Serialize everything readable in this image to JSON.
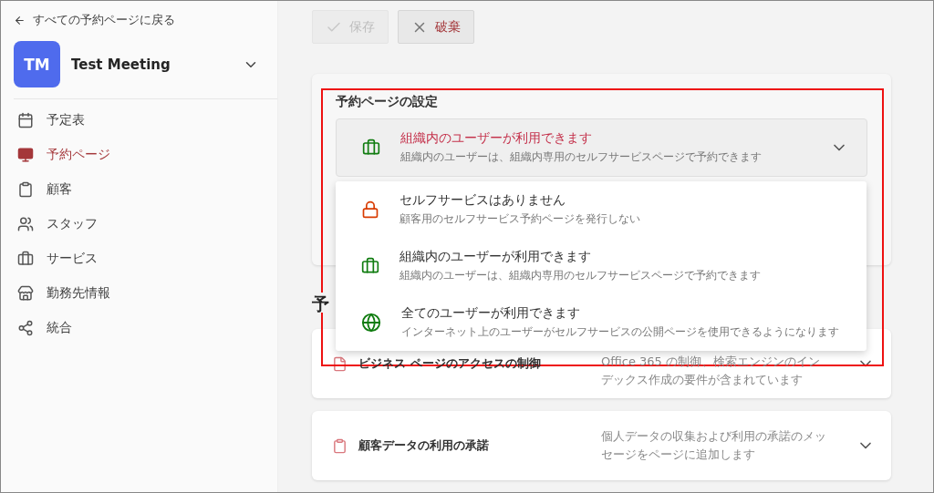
{
  "back_link": "すべての予約ページに戻る",
  "meeting": {
    "initials": "TM",
    "name": "Test Meeting"
  },
  "nav": [
    {
      "label": "予定表",
      "selected": false
    },
    {
      "label": "予約ページ",
      "selected": true
    },
    {
      "label": "顧客",
      "selected": false
    },
    {
      "label": "スタッフ",
      "selected": false
    },
    {
      "label": "サービス",
      "selected": false
    },
    {
      "label": "勤務先情報",
      "selected": false
    },
    {
      "label": "統合",
      "selected": false
    }
  ],
  "toolbar": [
    {
      "label": "保存",
      "disabled": true
    },
    {
      "label": "破棄",
      "disabled": false
    }
  ],
  "settings": {
    "title": "予約ページの設定",
    "select": {
      "kind": "organization",
      "title": "組織内のユーザーが利用できます",
      "subtitle": "組織内のユーザーは、組織内専用のセルフサービスページで予約できます",
      "expanded": true
    },
    "options": [
      {
        "kind": "locked",
        "title": "セルフサービスはありません",
        "subtitle": "顧客用のセルフサービス予約ページを発行しない"
      },
      {
        "kind": "organization",
        "title": "組織内のユーザーが利用できます",
        "subtitle": "組織内のユーザーは、組織内専用のセルフサービスページで予約できます"
      },
      {
        "kind": "public",
        "title": "全てのユーザーが利用できます",
        "subtitle": "インターネット上のユーザーがセルフサービスの公開ページを使用できるようになります"
      }
    ]
  },
  "section_heading": "予",
  "sections": [
    {
      "title": "ビジネス ページのアクセスの制御",
      "description": "Office 365 の制御、検索エンジンのインデックス作成の要件が含まれています"
    },
    {
      "title": "顧客データの利用の承諾",
      "description": "個人データの収集および利用の承諾のメッセージをページに追加します"
    }
  ]
}
